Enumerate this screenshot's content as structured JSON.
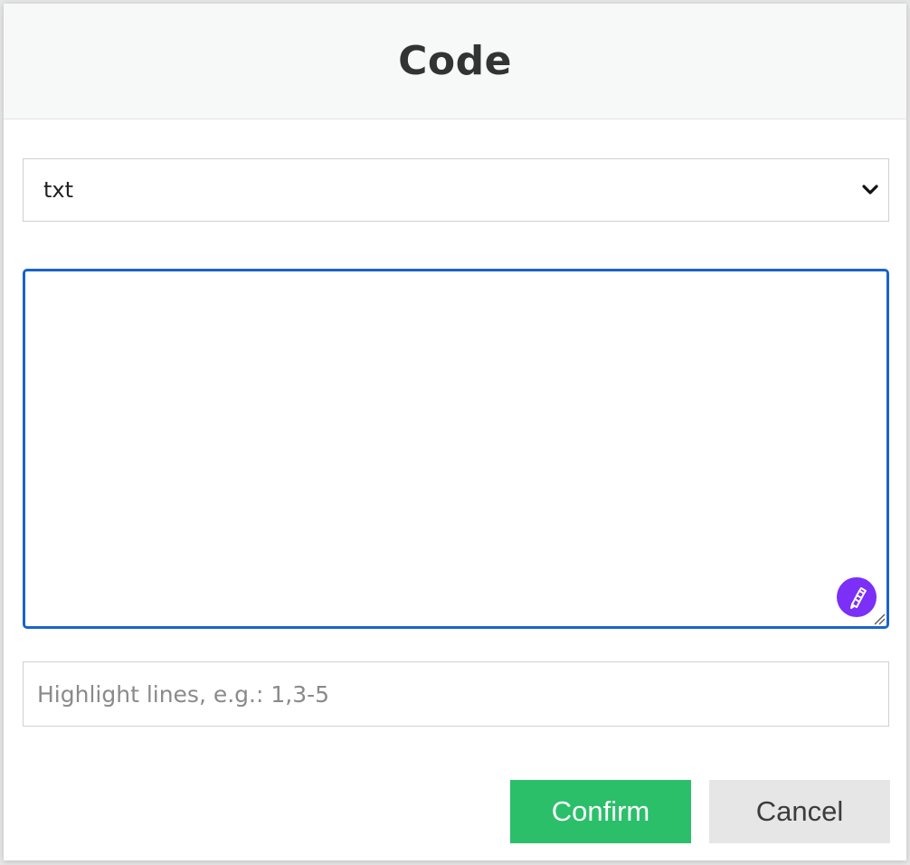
{
  "dialog": {
    "title": "Code"
  },
  "language_select": {
    "selected": "txt",
    "icon": "chevron-down-icon"
  },
  "code_editor": {
    "value": "",
    "assist_icon": "pen-icon",
    "assist_color": "#7b2ff7",
    "focus_color": "#1a64c8"
  },
  "highlight_lines": {
    "value": "",
    "placeholder": "Highlight lines, e.g.: 1,3-5"
  },
  "actions": {
    "confirm_label": "Confirm",
    "confirm_color": "#2bbf6a",
    "cancel_label": "Cancel",
    "cancel_color": "#e6e6e6"
  }
}
